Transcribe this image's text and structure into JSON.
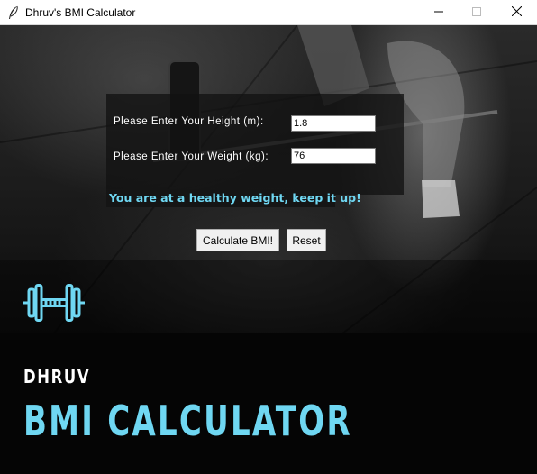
{
  "window": {
    "title": "Dhruv's BMI Calculator",
    "icon": "feather-icon",
    "controls": [
      "minimize-icon",
      "maximize-icon",
      "close-icon"
    ]
  },
  "form": {
    "height_label": "Please Enter Your Height (m):",
    "height_value": "1.8",
    "weight_label": "Please Enter Your Weight (kg):",
    "weight_value": "76"
  },
  "result": {
    "message": "You are at a healthy weight, keep it up!"
  },
  "buttons": {
    "calculate_label": "Calculate BMI!",
    "reset_label": "Reset"
  },
  "branding": {
    "logo_icon": "dumbbell-icon",
    "author": "DHRUV",
    "app_name": "BMI CALCULATOR",
    "accent_color": "#6fd7f2"
  }
}
